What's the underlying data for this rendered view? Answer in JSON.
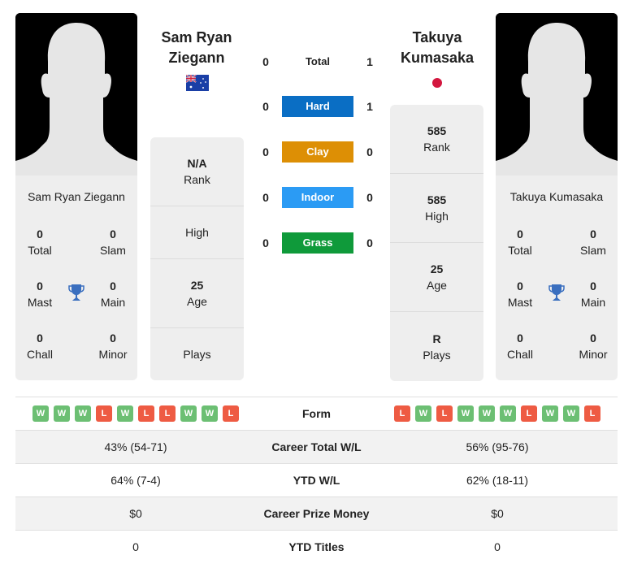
{
  "colors": {
    "hard": "#0a6ec4",
    "clay": "#dd8f05",
    "indoor": "#2b9bf4",
    "grass": "#0f9a3a",
    "win": "#6cbf73",
    "loss": "#ee5b43",
    "trophy": "#3a6fbf"
  },
  "player1": {
    "name_heading": "Sam Ryan Ziegann",
    "card_name": "Sam Ryan Ziegann",
    "flag_icon": "australia-flag-icon",
    "titles": {
      "total": {
        "value": "0",
        "label": "Total"
      },
      "slam": {
        "value": "0",
        "label": "Slam"
      },
      "mast": {
        "value": "0",
        "label": "Mast"
      },
      "main": {
        "value": "0",
        "label": "Main"
      },
      "chall": {
        "value": "0",
        "label": "Chall"
      },
      "minor": {
        "value": "0",
        "label": "Minor"
      }
    },
    "info": {
      "rank": {
        "value": "N/A",
        "label": "Rank"
      },
      "high": {
        "value": "",
        "label": "High"
      },
      "age": {
        "value": "25",
        "label": "Age"
      },
      "plays": {
        "value": "",
        "label": "Plays"
      }
    },
    "form": [
      "W",
      "W",
      "W",
      "L",
      "W",
      "L",
      "L",
      "W",
      "W",
      "L"
    ]
  },
  "player2": {
    "name_heading": "Takuya Kumasaka",
    "card_name": "Takuya Kumasaka",
    "flag_icon": "japan-flag-icon",
    "titles": {
      "total": {
        "value": "0",
        "label": "Total"
      },
      "slam": {
        "value": "0",
        "label": "Slam"
      },
      "mast": {
        "value": "0",
        "label": "Mast"
      },
      "main": {
        "value": "0",
        "label": "Main"
      },
      "chall": {
        "value": "0",
        "label": "Chall"
      },
      "minor": {
        "value": "0",
        "label": "Minor"
      }
    },
    "info": {
      "rank": {
        "value": "585",
        "label": "Rank"
      },
      "high": {
        "value": "585",
        "label": "High"
      },
      "age": {
        "value": "25",
        "label": "Age"
      },
      "plays": {
        "value": "R",
        "label": "Plays"
      }
    },
    "form": [
      "L",
      "W",
      "L",
      "W",
      "W",
      "W",
      "L",
      "W",
      "W",
      "L"
    ]
  },
  "h2h": {
    "total": {
      "label": "Total",
      "left": "0",
      "right": "1"
    },
    "hard": {
      "label": "Hard",
      "left": "0",
      "right": "1"
    },
    "clay": {
      "label": "Clay",
      "left": "0",
      "right": "0"
    },
    "indoor": {
      "label": "Indoor",
      "left": "0",
      "right": "0"
    },
    "grass": {
      "label": "Grass",
      "left": "0",
      "right": "0"
    }
  },
  "table": {
    "form_label": "Form",
    "rows": [
      {
        "label": "Career Total W/L",
        "left": "43% (54-71)",
        "right": "56% (95-76)"
      },
      {
        "label": "YTD W/L",
        "left": "64% (7-4)",
        "right": "62% (18-11)"
      },
      {
        "label": "Career Prize Money",
        "left": "$0",
        "right": "$0"
      },
      {
        "label": "YTD Titles",
        "left": "0",
        "right": "0"
      }
    ]
  }
}
